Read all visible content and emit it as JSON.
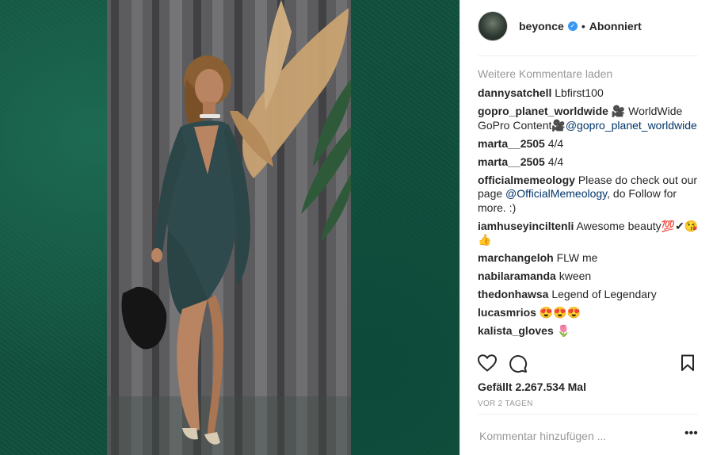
{
  "post": {
    "username": "beyonce",
    "verified_icon": "verified-badge-icon",
    "separator": "•",
    "follow_status": "Abonniert",
    "load_more": "Weitere Kommentare laden",
    "comments": [
      {
        "user": "dannysatchell",
        "parts": [
          {
            "t": "Lbfirst100"
          }
        ]
      },
      {
        "user": "gopro_planet_worldwide",
        "parts": [
          {
            "t": "🎥 WorldWide GoPro Content🎥"
          },
          {
            "t": "@gopro_planet_worldwide",
            "mention": true
          }
        ]
      },
      {
        "user": "marta__2505",
        "parts": [
          {
            "t": "4/4"
          }
        ]
      },
      {
        "user": "marta__2505",
        "parts": [
          {
            "t": "4/4"
          }
        ]
      },
      {
        "user": "officialmemeology",
        "parts": [
          {
            "t": "Please do check out our page "
          },
          {
            "t": "@OfficialMemeology",
            "mention": true
          },
          {
            "t": ", do Follow for more. :)"
          }
        ]
      },
      {
        "user": "iamhuseyinciltenli",
        "parts": [
          {
            "t": "Awesome beauty💯✔😘👍"
          }
        ]
      },
      {
        "user": "marchangeloh",
        "parts": [
          {
            "t": "FLW me"
          }
        ]
      },
      {
        "user": "nabilaramanda",
        "parts": [
          {
            "t": "kween"
          }
        ]
      },
      {
        "user": "thedonhawsa",
        "parts": [
          {
            "t": "Legend of Legendary"
          }
        ]
      },
      {
        "user": "lucasmrios",
        "parts": [
          {
            "t": "😍😍😍"
          }
        ]
      },
      {
        "user": "kalista_gloves",
        "parts": [
          {
            "t": "🌷"
          }
        ]
      }
    ],
    "likes": "Gefällt 2.267.534 Mal",
    "time": "VOR 2 TAGEN",
    "comment_placeholder": "Kommentar hinzufügen ...",
    "more_label": "•••",
    "icons": [
      "heart-icon",
      "comment-icon",
      "bookmark-icon",
      "more-options-icon"
    ],
    "colors": {
      "background_green": "#11503d",
      "text": "#262626",
      "muted": "#999999",
      "mention": "#003569",
      "verified": "#3897f0"
    }
  }
}
